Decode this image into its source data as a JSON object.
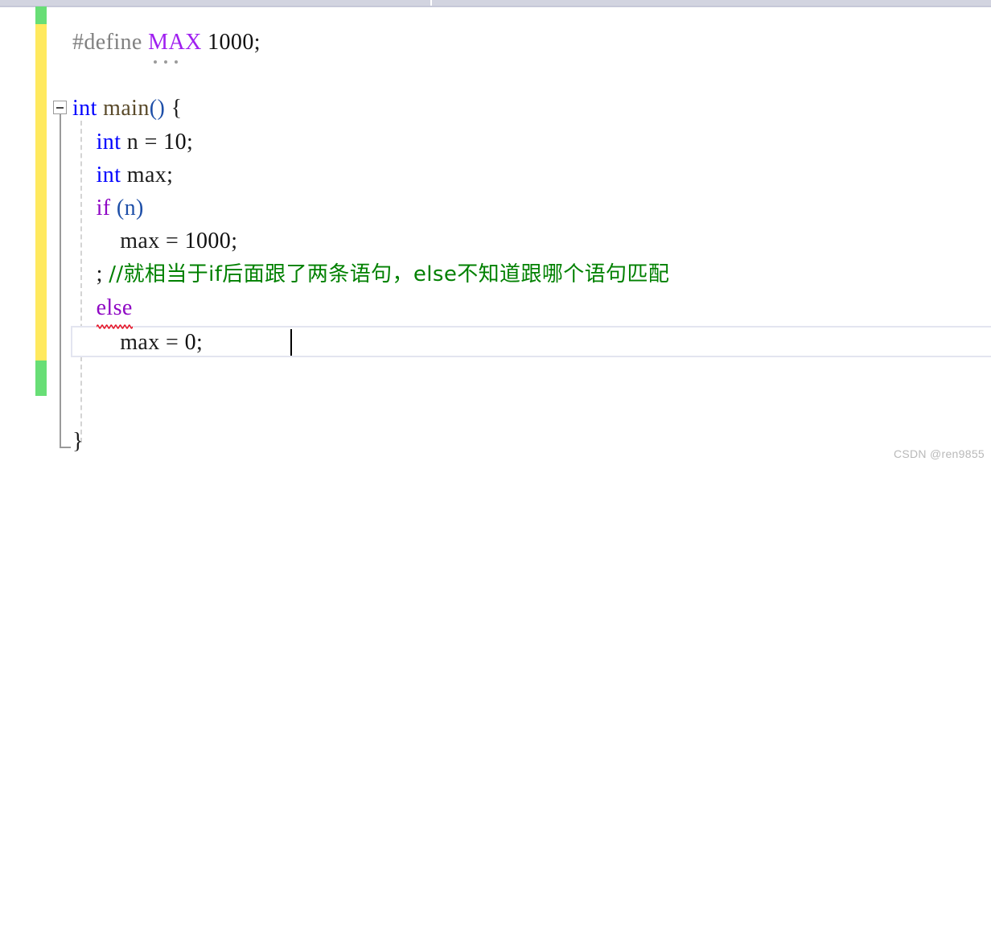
{
  "app": {
    "kind": "code-editor",
    "language": "C",
    "watermark": "CSDN @ren9855"
  },
  "top_strip": {
    "background": "#d2d4e0"
  },
  "gutter": {
    "track_changes_bar": {
      "saved_color": "#68de76",
      "unsaved_color": "#ffe95e",
      "segments": [
        {
          "state": "saved",
          "color": "#68de76"
        },
        {
          "state": "unsaved",
          "color": "#ffe95e"
        },
        {
          "state": "saved",
          "color": "#68de76"
        }
      ]
    },
    "outlining": {
      "collapse_toggle_label": "−",
      "state": "expanded"
    }
  },
  "editor": {
    "current_line_index": 9,
    "caret_after": "max = 0;",
    "colors": {
      "keyword": "#0000ff",
      "control_keyword": "#8f08c4",
      "macro": "#a020f0",
      "preprocessor": "#808080",
      "comment": "#008000",
      "plain": "#1c1c1c",
      "error_squiggle": "#e81123",
      "current_line_border": "#e3e5f0",
      "indent_guide": "#d4d4d4"
    },
    "lines": [
      {
        "n": 1,
        "text": "#define MAX 1000;",
        "tokens": {
          "preproc": "#define",
          "space1": " ",
          "macro": "MAX",
          "space2": " ",
          "number": "1000",
          "semi": ";"
        },
        "has_smarttag": true
      },
      {
        "n": 2,
        "text": ""
      },
      {
        "n": 3,
        "text": "int main() {",
        "tokens": {
          "keyword": "int",
          "space1": " ",
          "func": "main",
          "parens": "()",
          "space2": " ",
          "brace": "{"
        }
      },
      {
        "n": 4,
        "text": "    int n = 10;",
        "tokens": {
          "indent": "    ",
          "keyword": "int",
          "rest": " n = ",
          "number": "10",
          "semi": ";"
        }
      },
      {
        "n": 5,
        "text": "    int max;",
        "tokens": {
          "indent": "    ",
          "keyword": "int",
          "rest": " max;"
        }
      },
      {
        "n": 6,
        "text": "    if (n)",
        "tokens": {
          "indent": "    ",
          "ctrl": "if",
          "space": " ",
          "parens": "(n)"
        }
      },
      {
        "n": 7,
        "text": "        max = 1000;",
        "tokens": {
          "indent": "        ",
          "plain": "max = ",
          "number": "1000",
          "semi": ";"
        }
      },
      {
        "n": 8,
        "text": "    ; //就相当于if后面跟了两条语句，else不知道跟哪个语句匹配",
        "tokens": {
          "indent": "    ",
          "semi": ";",
          "space": " ",
          "comment": "//就相当于if后面跟了两条语句，else不知道跟哪个语句匹配"
        }
      },
      {
        "n": 9,
        "text": "    else",
        "tokens": {
          "indent": "    ",
          "ctrl": "else"
        },
        "has_error_squiggle": true
      },
      {
        "n": 10,
        "text": "        max = 0;",
        "tokens": {
          "indent": "        ",
          "plain": "max = ",
          "number": "0",
          "semi": ";"
        },
        "is_current_line": true
      },
      {
        "n": 11,
        "text": ""
      },
      {
        "n": 12,
        "text": ""
      },
      {
        "n": 13,
        "text": "}",
        "tokens": {
          "brace": "}"
        }
      }
    ]
  }
}
